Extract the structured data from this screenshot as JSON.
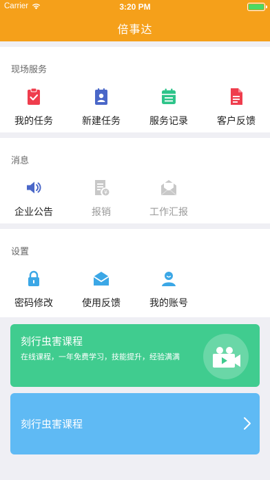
{
  "status": {
    "carrier": "Carrier",
    "time": "3:20 PM"
  },
  "header": {
    "title": "倍事达"
  },
  "sections": {
    "onsite": {
      "title": "现场服务",
      "items": [
        {
          "label": "我的任务",
          "icon": "clipboard-check-icon",
          "color": "#ef3d4d"
        },
        {
          "label": "新建任务",
          "icon": "id-card-icon",
          "color": "#4a67c8"
        },
        {
          "label": "服务记录",
          "icon": "calendar-icon",
          "color": "#2ec48a"
        },
        {
          "label": "客户反馈",
          "icon": "document-icon",
          "color": "#ef3d4d"
        }
      ]
    },
    "messages": {
      "title": "消息",
      "items": [
        {
          "label": "企业公告",
          "icon": "speaker-icon",
          "color": "#4a67c8"
        },
        {
          "label": "报销",
          "icon": "receipt-icon",
          "color": "#c8c8c8"
        },
        {
          "label": "工作汇报",
          "icon": "envelope-icon",
          "color": "#c8c8c8"
        }
      ]
    },
    "settings": {
      "title": "设置",
      "items": [
        {
          "label": "密码修改",
          "icon": "lock-icon",
          "color": "#3ba7e6"
        },
        {
          "label": "使用反馈",
          "icon": "mail-open-icon",
          "color": "#3ba7e6"
        },
        {
          "label": "我的账号",
          "icon": "user-icon",
          "color": "#3ba7e6"
        }
      ]
    }
  },
  "promo_green": {
    "title": "刻行虫害课程",
    "desc": "在线课程，一年免费学习，技能提升，经验满满",
    "icon": "video-camera-icon"
  },
  "promo_blue": {
    "title": "刻行虫害课程",
    "icon": "chevron-right-icon"
  }
}
